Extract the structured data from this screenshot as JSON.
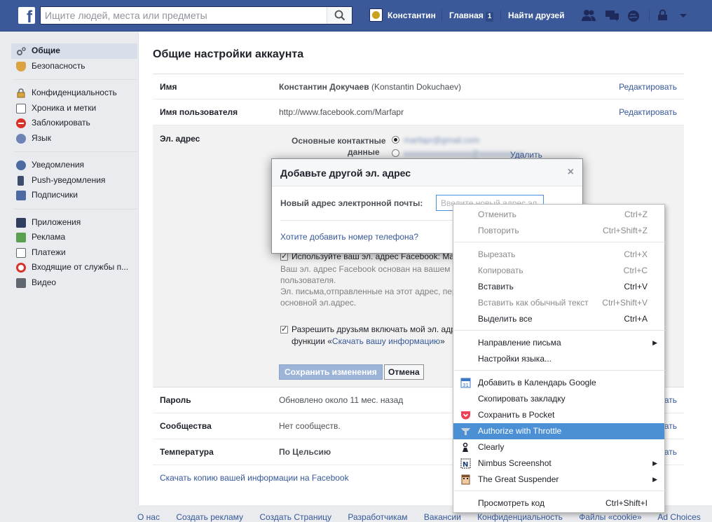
{
  "topbar": {
    "logo": "f",
    "search_placeholder": "Ищите людей, места или предметы",
    "user_name": "Константин",
    "home_label": "Главная",
    "home_badge": "1",
    "find_friends": "Найти друзей",
    "brand_color": "#3b5998"
  },
  "leftnav": {
    "groups": [
      [
        {
          "label": "Общие",
          "icon": "gear-icon",
          "active": true
        },
        {
          "label": "Безопасность",
          "icon": "shield-icon"
        }
      ],
      [
        {
          "label": "Конфиденциальность",
          "icon": "lock-icon"
        },
        {
          "label": "Хроника и метки",
          "icon": "timeline-icon"
        },
        {
          "label": "Заблокировать",
          "icon": "block-icon"
        },
        {
          "label": "Язык",
          "icon": "globe-icon"
        }
      ],
      [
        {
          "label": "Уведомления",
          "icon": "globe-icon"
        },
        {
          "label": "Push-уведомления",
          "icon": "phone-icon"
        },
        {
          "label": "Подписчики",
          "icon": "rss-icon"
        }
      ],
      [
        {
          "label": "Приложения",
          "icon": "apps-icon"
        },
        {
          "label": "Реклама",
          "icon": "ads-icon"
        },
        {
          "label": "Платежи",
          "icon": "payments-icon"
        },
        {
          "label": "Входящие от службы п...",
          "icon": "lifebuoy-icon"
        },
        {
          "label": "Видео",
          "icon": "video-icon"
        }
      ]
    ]
  },
  "main": {
    "title": "Общие настройки аккаунта",
    "rows": {
      "name": {
        "label": "Имя",
        "value": "Константин Докучаев",
        "value_alt": "(Konstantin Dokuchaev)",
        "edit": "Редактировать"
      },
      "username": {
        "label": "Имя пользователя",
        "value": "http://www.facebook.com/Marfapr",
        "edit": "Редактировать"
      },
      "email": {
        "label": "Эл. адрес",
        "primary_label_1": "Основные контактные",
        "primary_label_2": "данные",
        "email1": "marfapr@gmail.com",
        "email2": "xxxxxxxxxxxxxxxx@xxxxxxxx.xx",
        "remove": "Удалить",
        "fb_email_check": "Используйте ваш эл. адрес Facebook: Ma",
        "fb_email_desc_1": "Ваш эл. адрес Facebook основан на вашем",
        "fb_email_desc_2": "пользователя.",
        "fb_email_desc_3": "Эл. письма,отправленные на этот адрес, пер",
        "fb_email_desc_4": "основной эл.адрес.",
        "download_check_1": "Разрешить друзьям включать мой эл. адр",
        "download_check_2a": "функции «",
        "download_check_link": "Скачать вашу информацию",
        "download_check_2b": "»",
        "save": "Сохранить изменения",
        "cancel": "Отмена"
      },
      "password": {
        "label": "Пароль",
        "value": "Обновлено около 11 мес. назад",
        "edit": "ать"
      },
      "networks": {
        "label": "Сообщества",
        "value": "Нет сообществ.",
        "edit": "ать"
      },
      "temperature": {
        "label": "Температура",
        "value": "По Цельсию",
        "edit": "ать"
      }
    },
    "download_link": "Скачать копию вашей информации на Facebook"
  },
  "footer": [
    "О нас",
    "Создать рекламу",
    "Создать Страницу",
    "Разработчикам",
    "Вакансии",
    "Конфиденциальность",
    "Файлы «cookie»",
    "Ad Choices"
  ],
  "modal": {
    "title": "Добавьте другой эл. адрес",
    "close": "×",
    "label": "Новый адрес электронной почты:",
    "placeholder": "Введите новый адрес эл.",
    "phone_link": "Хотите добавить номер телефона?"
  },
  "context_menu": {
    "undo": {
      "label": "Отменить",
      "shortcut": "Ctrl+Z"
    },
    "redo": {
      "label": "Повторить",
      "shortcut": "Ctrl+Shift+Z"
    },
    "cut": {
      "label": "Вырезать",
      "shortcut": "Ctrl+X"
    },
    "copy": {
      "label": "Копировать",
      "shortcut": "Ctrl+C"
    },
    "paste": {
      "label": "Вставить",
      "shortcut": "Ctrl+V"
    },
    "paste_plain": {
      "label": "Вставить как обычный текст",
      "shortcut": "Ctrl+Shift+V"
    },
    "select_all": {
      "label": "Выделить все",
      "shortcut": "Ctrl+A"
    },
    "writing_direction": {
      "label": "Направление письма"
    },
    "language_settings": {
      "label": "Настройки языка..."
    },
    "google_calendar": {
      "label": "Добавить в Календарь Google",
      "icon": "calendar-icon"
    },
    "copy_bookmark": {
      "label": "Скопировать закладку",
      "icon": "bookmark-icon"
    },
    "pocket": {
      "label": "Сохранить в Pocket",
      "icon": "pocket-icon"
    },
    "throttle": {
      "label": "Authorize with Throttle",
      "icon": "throttle-icon"
    },
    "clearly": {
      "label": "Clearly",
      "icon": "clearly-icon"
    },
    "nimbus": {
      "label": "Nimbus Screenshot",
      "icon": "nimbus-icon"
    },
    "suspender": {
      "label": "The Great Suspender",
      "icon": "suspender-icon"
    },
    "inspect": {
      "label": "Просмотреть код",
      "shortcut": "Ctrl+Shift+I"
    },
    "highlight_color": "#4b8fd5"
  }
}
